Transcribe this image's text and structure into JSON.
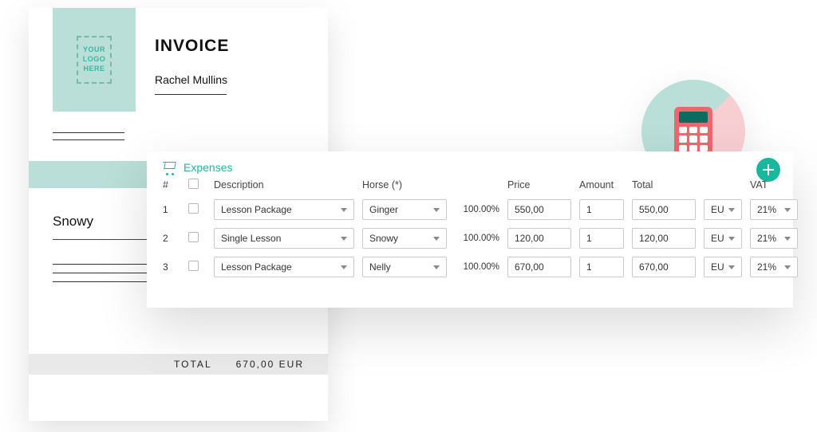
{
  "invoice": {
    "logo_placeholder": "YOUR\nLOGO\nHERE",
    "title": "INVOICE",
    "customer_name": "Rachel Mullins",
    "horse_name": "Snowy",
    "total_label": "TOTAL",
    "total_value": "670,00 EUR"
  },
  "expenses": {
    "title": "Expenses",
    "columns": {
      "hash": "#",
      "description": "Description",
      "horse": "Horse (*)",
      "price": "Price",
      "amount": "Amount",
      "total": "Total",
      "vat": "VAT"
    },
    "rows": [
      {
        "n": "1",
        "description": "Lesson Package",
        "horse": "Ginger",
        "pct": "100.00%",
        "price": "550,00",
        "amount": "1",
        "total": "550,00",
        "region": "EU",
        "vat": "21%"
      },
      {
        "n": "2",
        "description": "Single Lesson",
        "horse": "Snowy",
        "pct": "100.00%",
        "price": "120,00",
        "amount": "1",
        "total": "120,00",
        "region": "EU",
        "vat": "21%"
      },
      {
        "n": "3",
        "description": "Lesson Package",
        "horse": "Nelly",
        "pct": "100.00%",
        "price": "670,00",
        "amount": "1",
        "total": "670,00",
        "region": "EU",
        "vat": "21%"
      }
    ]
  }
}
